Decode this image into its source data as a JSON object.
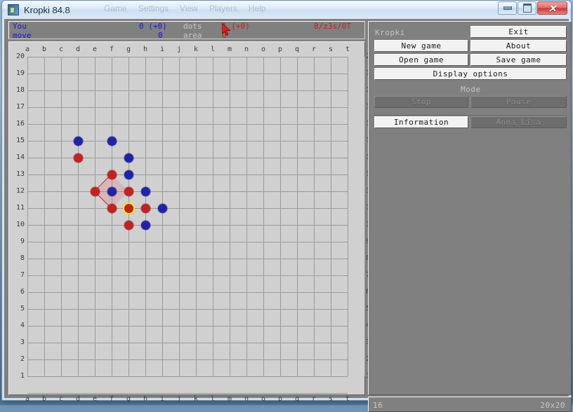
{
  "window": {
    "title": "Kropki 84.8",
    "icon": "app-icon",
    "ghost_menu": [
      "Game",
      "Settings",
      "View",
      "Players",
      "Help"
    ],
    "buttons": {
      "minimize": "minimize",
      "maximize": "maximize",
      "close": "close"
    }
  },
  "status": {
    "player_label": "You",
    "move_label": "move",
    "score_value": "0 (+0)",
    "move_value": "0",
    "dots_label": "dots",
    "area_label": "area",
    "dots_value": "1 (+0)",
    "area_value": "0",
    "timer": "8/z3s/0T"
  },
  "board": {
    "columns": [
      "a",
      "b",
      "c",
      "d",
      "e",
      "f",
      "g",
      "h",
      "i",
      "j",
      "k",
      "l",
      "m",
      "n",
      "o",
      "p",
      "q",
      "r",
      "s",
      "t"
    ],
    "rows": [
      20,
      19,
      18,
      17,
      16,
      15,
      14,
      13,
      12,
      11,
      10,
      9,
      8,
      7,
      6,
      5,
      4,
      3,
      2,
      1
    ],
    "size_label": "20x20",
    "grid_color": "#9a9a9a",
    "background": "#d0d0d0",
    "blue_color": "#1f23a8",
    "red_color": "#c22222",
    "select_color": "#ffe400",
    "dots": [
      {
        "col": "d",
        "row": 15,
        "color": "blue"
      },
      {
        "col": "f",
        "row": 15,
        "color": "blue"
      },
      {
        "col": "d",
        "row": 14,
        "color": "red"
      },
      {
        "col": "g",
        "row": 14,
        "color": "blue"
      },
      {
        "col": "f",
        "row": 13,
        "color": "red"
      },
      {
        "col": "g",
        "row": 13,
        "color": "blue"
      },
      {
        "col": "e",
        "row": 12,
        "color": "red"
      },
      {
        "col": "f",
        "row": 12,
        "color": "blue"
      },
      {
        "col": "g",
        "row": 12,
        "color": "red"
      },
      {
        "col": "h",
        "row": 12,
        "color": "blue"
      },
      {
        "col": "f",
        "row": 11,
        "color": "red"
      },
      {
        "col": "g",
        "row": 11,
        "color": "red",
        "selected": true
      },
      {
        "col": "h",
        "row": 11,
        "color": "red"
      },
      {
        "col": "i",
        "row": 11,
        "color": "blue"
      },
      {
        "col": "g",
        "row": 10,
        "color": "red"
      },
      {
        "col": "h",
        "row": 10,
        "color": "blue"
      }
    ],
    "chains": [
      {
        "from": {
          "col": "f",
          "row": 13
        },
        "to": {
          "col": "e",
          "row": 12
        }
      },
      {
        "from": {
          "col": "e",
          "row": 12
        },
        "to": {
          "col": "f",
          "row": 11
        }
      }
    ],
    "territory": [
      {
        "col": "f",
        "row": 13
      },
      {
        "col": "e",
        "row": 12
      },
      {
        "col": "f",
        "row": 12
      },
      {
        "col": "g",
        "row": 12
      },
      {
        "col": "f",
        "row": 11
      }
    ]
  },
  "side": {
    "app_label": "Kropki",
    "mode_label": "Mode",
    "new_game": "New game",
    "open_game": "Open game",
    "display_options": "Display options",
    "exit": "Exit",
    "about": "About",
    "save_game": "Save game",
    "stop": "Stop",
    "pause": "Pause",
    "information": "Information",
    "player_name": "Anna Lisa"
  },
  "bottom": {
    "left": "16",
    "right": "20x20"
  }
}
